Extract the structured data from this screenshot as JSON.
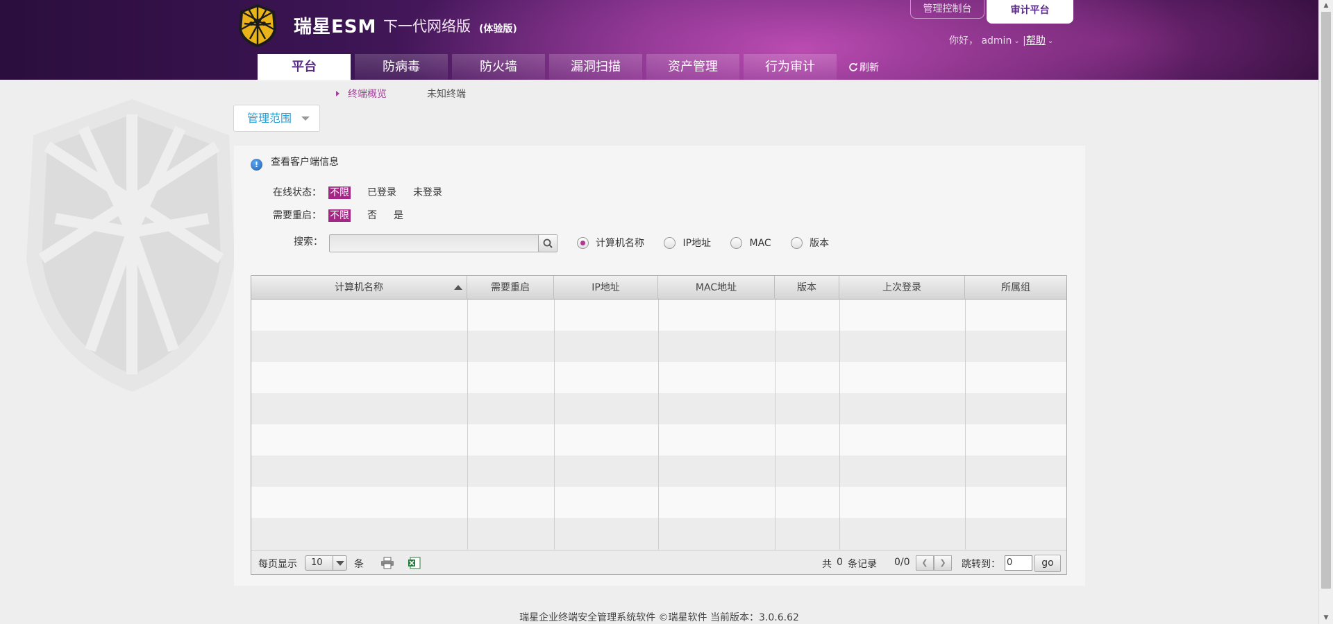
{
  "header": {
    "brand_title": "瑞星ESM",
    "brand_subtitle": "下一代网络版",
    "brand_badge": "(体验版)",
    "top_tabs": {
      "console": "管理控制台",
      "audit": "审计平台"
    },
    "greeting": "你好，",
    "username": "admin",
    "separator": "|",
    "help": "帮助",
    "refresh": "刷新"
  },
  "nav": {
    "items": [
      {
        "label": "平台"
      },
      {
        "label": "防病毒"
      },
      {
        "label": "防火墙"
      },
      {
        "label": "漏洞扫描"
      },
      {
        "label": "资产管理"
      },
      {
        "label": "行为审计"
      }
    ]
  },
  "subnav": {
    "overview": "终端概览",
    "unknown": "未知终端"
  },
  "scope_button": "管理范围",
  "panel": {
    "info": "查看客户端信息",
    "online_label": "在线状态：",
    "online_options": [
      "不限",
      "已登录",
      "未登录"
    ],
    "restart_label": "需要重启：",
    "restart_options": [
      "不限",
      "否",
      "是"
    ],
    "search_label": "搜索：",
    "search_value": "",
    "radios": [
      "计算机名称",
      "IP地址",
      "MAC",
      "版本"
    ]
  },
  "table": {
    "columns": [
      "计算机名称",
      "需要重启",
      "IP地址",
      "MAC地址",
      "版本",
      "上次登录",
      "所属组"
    ],
    "rows": []
  },
  "pager": {
    "per_page_label": "每页显示",
    "per_page_value": "10",
    "unit": "条",
    "total_prefix": "共",
    "total_count": "0",
    "total_suffix": "条记录",
    "page_info": "0/0",
    "jump_label": "跳转到：",
    "jump_value": "0",
    "go": "go"
  },
  "footer": "瑞星企业终端安全管理系统软件 ©瑞星软件    当前版本：3.0.6.62",
  "colors": {
    "accent": "#a42686",
    "brand": "#5b2c84",
    "link": "#21a0d6"
  }
}
